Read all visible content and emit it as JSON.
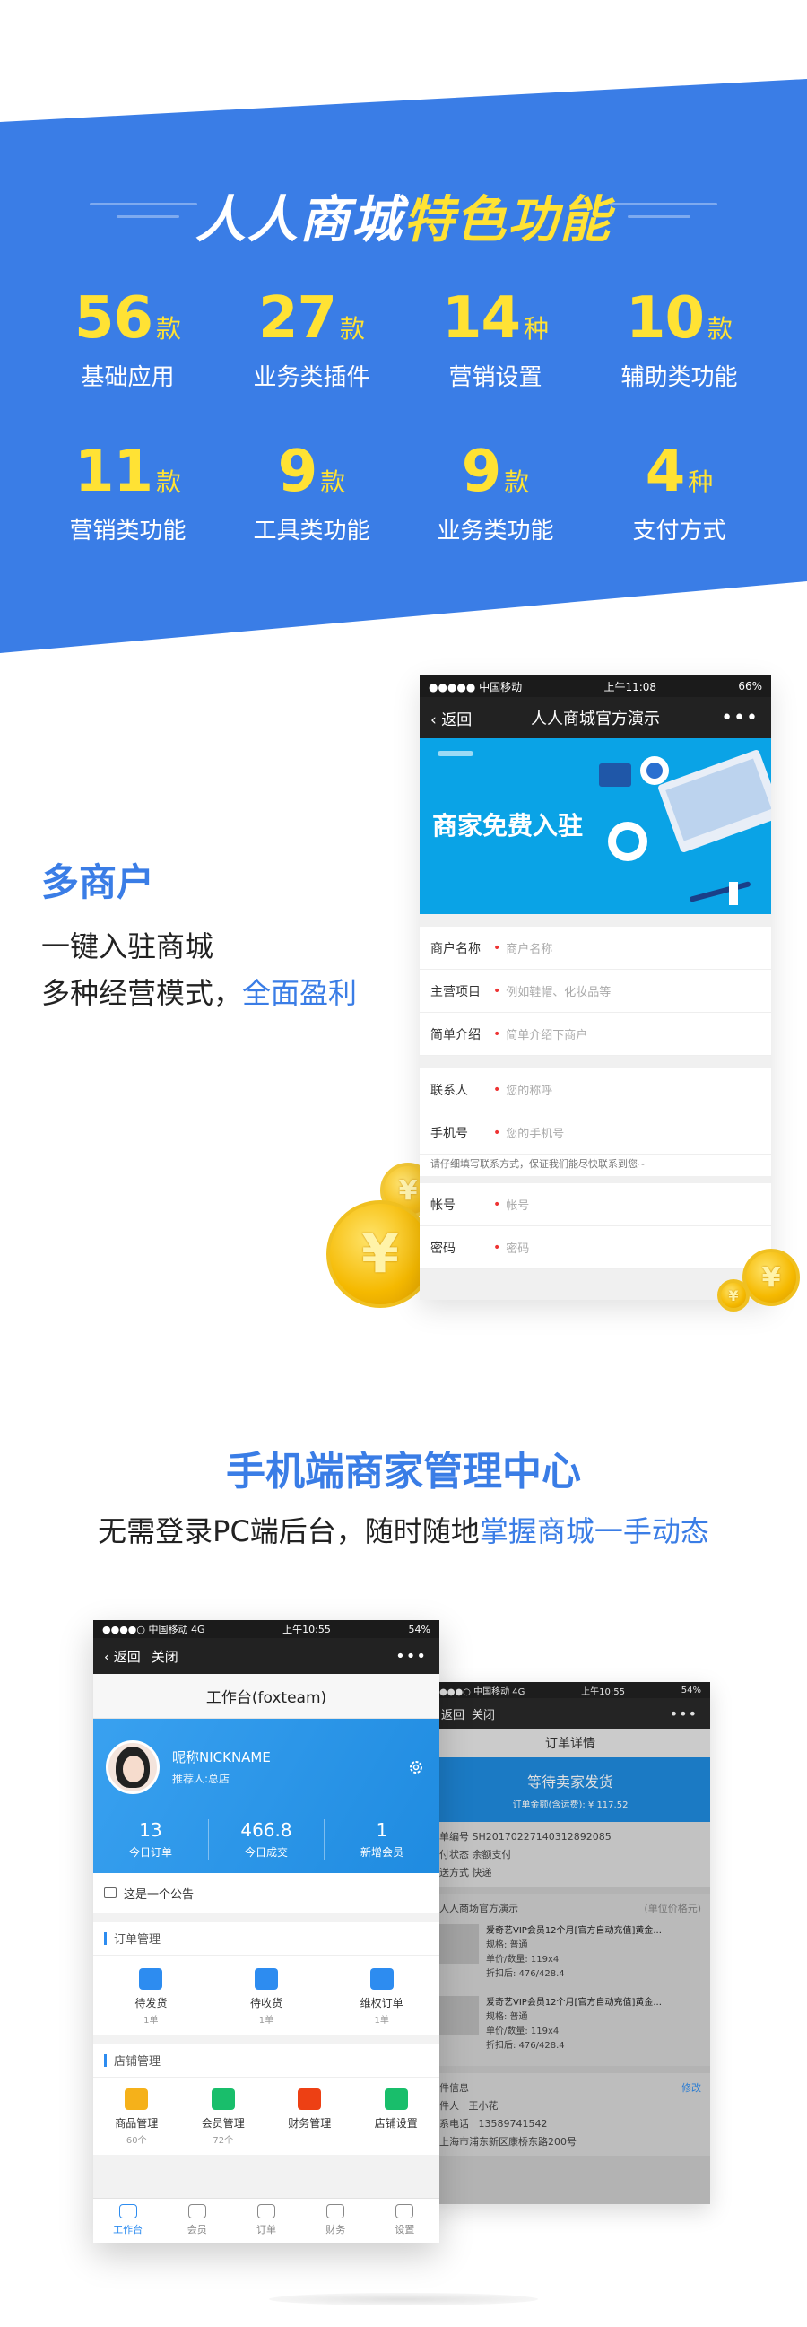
{
  "banner": {
    "title_part1": "人人商城",
    "title_part2": "特色功能",
    "stats": [
      {
        "value": "56",
        "unit": "款",
        "label": "基础应用"
      },
      {
        "value": "27",
        "unit": "款",
        "label": "业务类插件"
      },
      {
        "value": "14",
        "unit": "种",
        "label": "营销设置"
      },
      {
        "value": "10",
        "unit": "款",
        "label": "辅助类功能"
      },
      {
        "value": "11",
        "unit": "款",
        "label": "营销类功能"
      },
      {
        "value": "9",
        "unit": "款",
        "label": "工具类功能"
      },
      {
        "value": "9",
        "unit": "款",
        "label": "业务类功能"
      },
      {
        "value": "4",
        "unit": "种",
        "label": "支付方式"
      }
    ]
  },
  "merchant": {
    "heading": "多商户",
    "line1": "一键入驻商城",
    "line2_a": "多种经营模式，",
    "line2_b": "全面盈利",
    "phone": {
      "carrier": "●●●●● 中国移动 ",
      "time": "上午11:08",
      "battery": "66%",
      "back": "返回",
      "title": "人人商城官方演示",
      "more": "•••",
      "banner_text": "商家免费入驻",
      "fields_group1": [
        {
          "label": "商户名称",
          "placeholder": "商户名称"
        },
        {
          "label": "主营项目",
          "placeholder": "例如鞋帽、化妆品等"
        },
        {
          "label": "简单介绍",
          "placeholder": "简单介绍下商户"
        }
      ],
      "fields_group2": [
        {
          "label": "联系人",
          "placeholder": "您的称呼"
        },
        {
          "label": "手机号",
          "placeholder": "您的手机号"
        }
      ],
      "hint": "请仔细填写联系方式，保证我们能尽快联系到您~",
      "fields_group3": [
        {
          "label": "帐号",
          "placeholder": "帐号"
        },
        {
          "label": "密码",
          "placeholder": "密码"
        }
      ]
    },
    "coin_symbol": "¥"
  },
  "mgmt": {
    "heading": "手机端商家管理中心",
    "sub_a": "无需登录PC端后台，随时随地",
    "sub_b": "掌握商城一手动态",
    "front_phone": {
      "carrier": "●●●●○ 中国移动  4G",
      "time": "上午10:55",
      "battery": "54%",
      "back": "返回",
      "close": "关闭",
      "more": "•••",
      "header": "工作台(foxteam)",
      "nickname": "昵称NICKNAME",
      "referrer": "推荐人:总店",
      "metrics": [
        {
          "value": "13",
          "label": "今日订单"
        },
        {
          "value": "466.8",
          "label": "今日成交"
        },
        {
          "value": "1",
          "label": "新增会员"
        }
      ],
      "notice": "这是一个公告",
      "orders_title": "订单管理",
      "orders": [
        {
          "name": "待发货",
          "count": "1单",
          "color": "#2d8cf0"
        },
        {
          "name": "待收货",
          "count": "1单",
          "color": "#2d8cf0"
        },
        {
          "name": "维权订单",
          "count": "1单",
          "color": "#2d8cf0"
        }
      ],
      "shop_title": "店铺管理",
      "shop": [
        {
          "name": "商品管理",
          "count": "60个",
          "color": "#f5b11a"
        },
        {
          "name": "会员管理",
          "count": "72个",
          "color": "#19be6b"
        },
        {
          "name": "财务管理",
          "count": "",
          "color": "#ed4014"
        },
        {
          "name": "店铺设置",
          "count": "",
          "color": "#19be6b"
        }
      ],
      "tabs": [
        "工作台",
        "会员",
        "订单",
        "财务",
        "设置"
      ]
    },
    "back_phone": {
      "carrier": "●●●○ 中国移动  4G",
      "time": "上午10:55",
      "battery": "54%",
      "back": "返回",
      "close": "关闭",
      "more": "•••",
      "header": "订单详情",
      "status": "等待卖家发货",
      "amount": "订单金额(含运费): ¥ 117.52",
      "order_no": "单编号   SH20170227140312892085",
      "pay_status": "付状态   余额支付",
      "delivery": "送方式   快递",
      "store": "人人商场官方演示",
      "unit_note": "(单位价格元)",
      "item_name": "爱奇艺VIP会员12个月[官方自动充值]黄金...",
      "spec": "规格: 普通",
      "unit_qty": "单价/数量: 119x4",
      "discount": "折扣后: 476/428.4",
      "buyer_section": "件信息",
      "modify": "修改",
      "buyer_name_label": "件人",
      "buyer_name": "王小花",
      "buyer_phone_label": "系电话",
      "buyer_phone": "13589741542",
      "buyer_addr": "上海市浦东新区康桥东路200号"
    }
  }
}
